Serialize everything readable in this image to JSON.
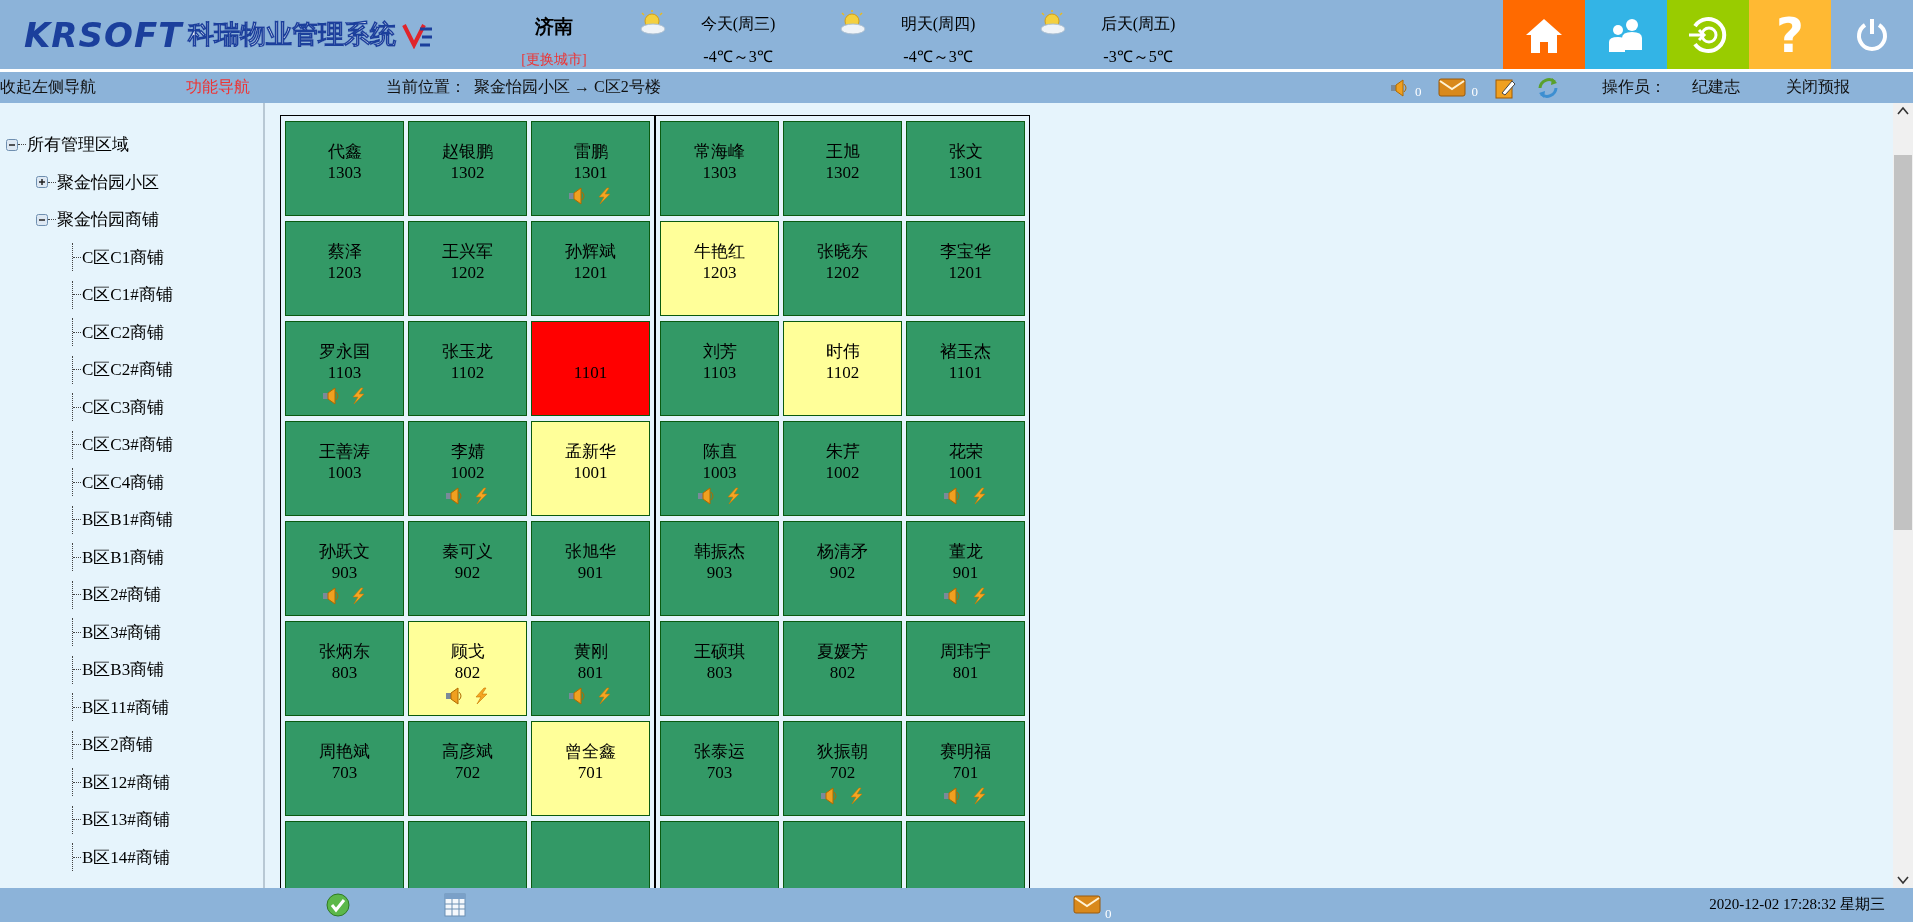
{
  "header": {
    "logo_latin": "KRSOFT",
    "logo_title": "科瑞物业管理系统",
    "city": "济南",
    "change_city": "[更换城市]",
    "forecast": [
      {
        "day": "今天(周三)",
        "temp": "-4℃～3℃"
      },
      {
        "day": "明天(周四)",
        "temp": "-4℃～3℃"
      },
      {
        "day": "后天(周五)",
        "temp": "-3℃～5℃"
      }
    ],
    "buttons": [
      {
        "kind": "home",
        "color": "#ff6a00"
      },
      {
        "kind": "users",
        "color": "#33b4e6"
      },
      {
        "kind": "switch",
        "color": "#99cc00"
      },
      {
        "kind": "help",
        "color": "#ffb933",
        "text": "?"
      },
      {
        "kind": "power",
        "color": "#8cb3d9"
      }
    ]
  },
  "nav": {
    "collapse": "收起左侧导航",
    "function_nav": "功能导航",
    "location_label": "当前位置：",
    "location": "聚金怡园小区 → C区2号楼",
    "sound_count": "0",
    "mail_count": "0",
    "operator_label": "操作员：",
    "operator": "纪建志",
    "close_forecast": "关闭预报"
  },
  "tree": {
    "label": "所有管理区域",
    "expanded": true,
    "children": [
      {
        "label": "聚金怡园小区",
        "expanded": false
      },
      {
        "label": "聚金怡园商铺",
        "expanded": true,
        "children": [
          {
            "label": "C区C1商铺"
          },
          {
            "label": "C区C1#商铺"
          },
          {
            "label": "C区C2商铺"
          },
          {
            "label": "C区C2#商铺"
          },
          {
            "label": "C区C3商铺"
          },
          {
            "label": "C区C3#商铺"
          },
          {
            "label": "C区C4商铺"
          },
          {
            "label": "B区B1#商铺"
          },
          {
            "label": "B区B1商铺"
          },
          {
            "label": "B区2#商铺"
          },
          {
            "label": "B区3#商铺"
          },
          {
            "label": "B区B3商铺"
          },
          {
            "label": "B区11#商铺"
          },
          {
            "label": "B区2商铺"
          },
          {
            "label": "B区12#商铺"
          },
          {
            "label": "B区13#商铺"
          },
          {
            "label": "B区14#商铺"
          }
        ]
      }
    ]
  },
  "blocks": [
    {
      "rows": [
        [
          {
            "name": "代鑫",
            "room": "1303",
            "color": "#339966",
            "alerts": false
          },
          {
            "name": "赵银鹏",
            "room": "1302",
            "color": "#339966",
            "alerts": false
          },
          {
            "name": "雷鹏",
            "room": "1301",
            "color": "#339966",
            "alerts": true
          }
        ],
        [
          {
            "name": "蔡泽",
            "room": "1203",
            "color": "#339966",
            "alerts": false
          },
          {
            "name": "王兴军",
            "room": "1202",
            "color": "#339966",
            "alerts": false
          },
          {
            "name": "孙辉斌",
            "room": "1201",
            "color": "#339966",
            "alerts": false
          }
        ],
        [
          {
            "name": "罗永国",
            "room": "1103",
            "color": "#339966",
            "alerts": true
          },
          {
            "name": "张玉龙",
            "room": "1102",
            "color": "#339966",
            "alerts": false
          },
          {
            "room": "1101",
            "color": "#ff0000",
            "alerts": false
          }
        ],
        [
          {
            "name": "王善涛",
            "room": "1003",
            "color": "#339966",
            "alerts": false
          },
          {
            "name": "李婧",
            "room": "1002",
            "color": "#339966",
            "alerts": true
          },
          {
            "name": "孟新华",
            "room": "1001",
            "color": "#ffff99",
            "alerts": false
          }
        ],
        [
          {
            "name": "孙跃文",
            "room": "903",
            "color": "#339966",
            "alerts": true
          },
          {
            "name": "秦可义",
            "room": "902",
            "color": "#339966",
            "alerts": false
          },
          {
            "name": "张旭华",
            "room": "901",
            "color": "#339966",
            "alerts": false
          }
        ],
        [
          {
            "name": "张炳东",
            "room": "803",
            "color": "#339966",
            "alerts": false
          },
          {
            "name": "顾戈",
            "room": "802",
            "color": "#ffff99",
            "alerts": true
          },
          {
            "name": "黄刚",
            "room": "801",
            "color": "#339966",
            "alerts": true
          }
        ],
        [
          {
            "name": "周艳斌",
            "room": "703",
            "color": "#339966",
            "alerts": false
          },
          {
            "name": "高彦斌",
            "room": "702",
            "color": "#339966",
            "alerts": false
          },
          {
            "name": "曾全鑫",
            "room": "701",
            "color": "#ffff99",
            "alerts": false
          }
        ],
        [
          {
            "color": "#339966",
            "alerts": false
          },
          {
            "color": "#339966",
            "alerts": false
          },
          {
            "color": "#339966",
            "alerts": false
          }
        ]
      ]
    },
    {
      "rows": [
        [
          {
            "name": "常海峰",
            "room": "1303",
            "color": "#339966",
            "alerts": false
          },
          {
            "name": "王旭",
            "room": "1302",
            "color": "#339966",
            "alerts": false
          },
          {
            "name": "张文",
            "room": "1301",
            "color": "#339966",
            "alerts": false
          }
        ],
        [
          {
            "name": "牛艳红",
            "room": "1203",
            "color": "#ffff99",
            "alerts": false
          },
          {
            "name": "张晓东",
            "room": "1202",
            "color": "#339966",
            "alerts": false
          },
          {
            "name": "李宝华",
            "room": "1201",
            "color": "#339966",
            "alerts": false
          }
        ],
        [
          {
            "name": "刘芳",
            "room": "1103",
            "color": "#339966",
            "alerts": false
          },
          {
            "name": "时伟",
            "room": "1102",
            "color": "#ffff99",
            "alerts": false
          },
          {
            "name": "褚玉杰",
            "room": "1101",
            "color": "#339966",
            "alerts": false
          }
        ],
        [
          {
            "name": "陈直",
            "room": "1003",
            "color": "#339966",
            "alerts": true
          },
          {
            "name": "朱芹",
            "room": "1002",
            "color": "#339966",
            "alerts": false
          },
          {
            "name": "花荣",
            "room": "1001",
            "color": "#339966",
            "alerts": true
          }
        ],
        [
          {
            "name": "韩振杰",
            "room": "903",
            "color": "#339966",
            "alerts": false
          },
          {
            "name": "杨清矛",
            "room": "902",
            "color": "#339966",
            "alerts": false
          },
          {
            "name": "董龙",
            "room": "901",
            "color": "#339966",
            "alerts": true
          }
        ],
        [
          {
            "name": "王硕琪",
            "room": "803",
            "color": "#339966",
            "alerts": false
          },
          {
            "name": "夏媛芳",
            "room": "802",
            "color": "#339966",
            "alerts": false
          },
          {
            "name": "周玮宇",
            "room": "801",
            "color": "#339966",
            "alerts": false
          }
        ],
        [
          {
            "name": "张泰运",
            "room": "703",
            "color": "#339966",
            "alerts": false
          },
          {
            "name": "狄振朝",
            "room": "702",
            "color": "#339966",
            "alerts": true
          },
          {
            "name": "赛明福",
            "room": "701",
            "color": "#339966",
            "alerts": true
          }
        ],
        [
          {
            "color": "#339966",
            "alerts": false
          },
          {
            "color": "#339966",
            "alerts": false
          },
          {
            "color": "#339966",
            "alerts": false
          }
        ]
      ]
    }
  ],
  "status_bar": {
    "mail_count": "0",
    "datetime": "2020-12-02 17:28:32 星期三"
  }
}
